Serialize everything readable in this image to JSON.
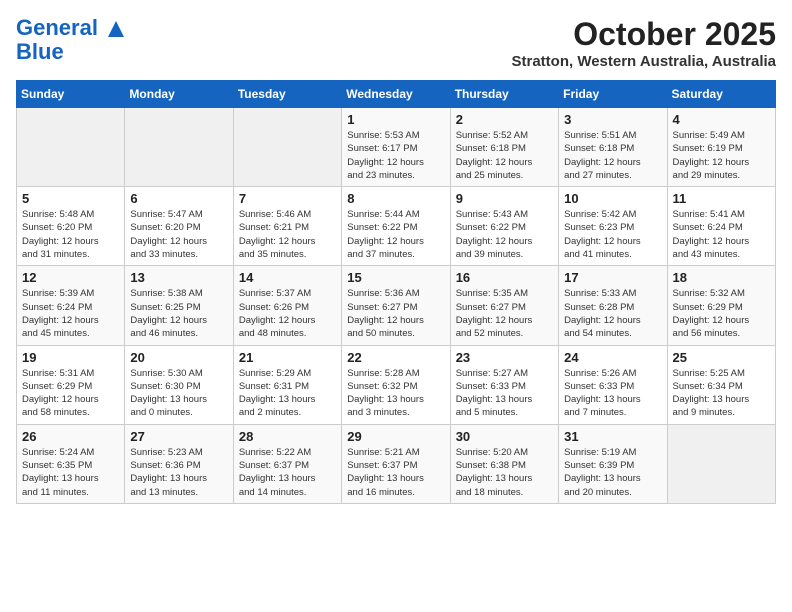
{
  "header": {
    "logo_line1": "General",
    "logo_line2": "Blue",
    "month": "October 2025",
    "location": "Stratton, Western Australia, Australia"
  },
  "weekdays": [
    "Sunday",
    "Monday",
    "Tuesday",
    "Wednesday",
    "Thursday",
    "Friday",
    "Saturday"
  ],
  "weeks": [
    [
      {
        "day": "",
        "info": ""
      },
      {
        "day": "",
        "info": ""
      },
      {
        "day": "",
        "info": ""
      },
      {
        "day": "1",
        "info": "Sunrise: 5:53 AM\nSunset: 6:17 PM\nDaylight: 12 hours\nand 23 minutes."
      },
      {
        "day": "2",
        "info": "Sunrise: 5:52 AM\nSunset: 6:18 PM\nDaylight: 12 hours\nand 25 minutes."
      },
      {
        "day": "3",
        "info": "Sunrise: 5:51 AM\nSunset: 6:18 PM\nDaylight: 12 hours\nand 27 minutes."
      },
      {
        "day": "4",
        "info": "Sunrise: 5:49 AM\nSunset: 6:19 PM\nDaylight: 12 hours\nand 29 minutes."
      }
    ],
    [
      {
        "day": "5",
        "info": "Sunrise: 5:48 AM\nSunset: 6:20 PM\nDaylight: 12 hours\nand 31 minutes."
      },
      {
        "day": "6",
        "info": "Sunrise: 5:47 AM\nSunset: 6:20 PM\nDaylight: 12 hours\nand 33 minutes."
      },
      {
        "day": "7",
        "info": "Sunrise: 5:46 AM\nSunset: 6:21 PM\nDaylight: 12 hours\nand 35 minutes."
      },
      {
        "day": "8",
        "info": "Sunrise: 5:44 AM\nSunset: 6:22 PM\nDaylight: 12 hours\nand 37 minutes."
      },
      {
        "day": "9",
        "info": "Sunrise: 5:43 AM\nSunset: 6:22 PM\nDaylight: 12 hours\nand 39 minutes."
      },
      {
        "day": "10",
        "info": "Sunrise: 5:42 AM\nSunset: 6:23 PM\nDaylight: 12 hours\nand 41 minutes."
      },
      {
        "day": "11",
        "info": "Sunrise: 5:41 AM\nSunset: 6:24 PM\nDaylight: 12 hours\nand 43 minutes."
      }
    ],
    [
      {
        "day": "12",
        "info": "Sunrise: 5:39 AM\nSunset: 6:24 PM\nDaylight: 12 hours\nand 45 minutes."
      },
      {
        "day": "13",
        "info": "Sunrise: 5:38 AM\nSunset: 6:25 PM\nDaylight: 12 hours\nand 46 minutes."
      },
      {
        "day": "14",
        "info": "Sunrise: 5:37 AM\nSunset: 6:26 PM\nDaylight: 12 hours\nand 48 minutes."
      },
      {
        "day": "15",
        "info": "Sunrise: 5:36 AM\nSunset: 6:27 PM\nDaylight: 12 hours\nand 50 minutes."
      },
      {
        "day": "16",
        "info": "Sunrise: 5:35 AM\nSunset: 6:27 PM\nDaylight: 12 hours\nand 52 minutes."
      },
      {
        "day": "17",
        "info": "Sunrise: 5:33 AM\nSunset: 6:28 PM\nDaylight: 12 hours\nand 54 minutes."
      },
      {
        "day": "18",
        "info": "Sunrise: 5:32 AM\nSunset: 6:29 PM\nDaylight: 12 hours\nand 56 minutes."
      }
    ],
    [
      {
        "day": "19",
        "info": "Sunrise: 5:31 AM\nSunset: 6:29 PM\nDaylight: 12 hours\nand 58 minutes."
      },
      {
        "day": "20",
        "info": "Sunrise: 5:30 AM\nSunset: 6:30 PM\nDaylight: 13 hours\nand 0 minutes."
      },
      {
        "day": "21",
        "info": "Sunrise: 5:29 AM\nSunset: 6:31 PM\nDaylight: 13 hours\nand 2 minutes."
      },
      {
        "day": "22",
        "info": "Sunrise: 5:28 AM\nSunset: 6:32 PM\nDaylight: 13 hours\nand 3 minutes."
      },
      {
        "day": "23",
        "info": "Sunrise: 5:27 AM\nSunset: 6:33 PM\nDaylight: 13 hours\nand 5 minutes."
      },
      {
        "day": "24",
        "info": "Sunrise: 5:26 AM\nSunset: 6:33 PM\nDaylight: 13 hours\nand 7 minutes."
      },
      {
        "day": "25",
        "info": "Sunrise: 5:25 AM\nSunset: 6:34 PM\nDaylight: 13 hours\nand 9 minutes."
      }
    ],
    [
      {
        "day": "26",
        "info": "Sunrise: 5:24 AM\nSunset: 6:35 PM\nDaylight: 13 hours\nand 11 minutes."
      },
      {
        "day": "27",
        "info": "Sunrise: 5:23 AM\nSunset: 6:36 PM\nDaylight: 13 hours\nand 13 minutes."
      },
      {
        "day": "28",
        "info": "Sunrise: 5:22 AM\nSunset: 6:37 PM\nDaylight: 13 hours\nand 14 minutes."
      },
      {
        "day": "29",
        "info": "Sunrise: 5:21 AM\nSunset: 6:37 PM\nDaylight: 13 hours\nand 16 minutes."
      },
      {
        "day": "30",
        "info": "Sunrise: 5:20 AM\nSunset: 6:38 PM\nDaylight: 13 hours\nand 18 minutes."
      },
      {
        "day": "31",
        "info": "Sunrise: 5:19 AM\nSunset: 6:39 PM\nDaylight: 13 hours\nand 20 minutes."
      },
      {
        "day": "",
        "info": ""
      }
    ]
  ]
}
